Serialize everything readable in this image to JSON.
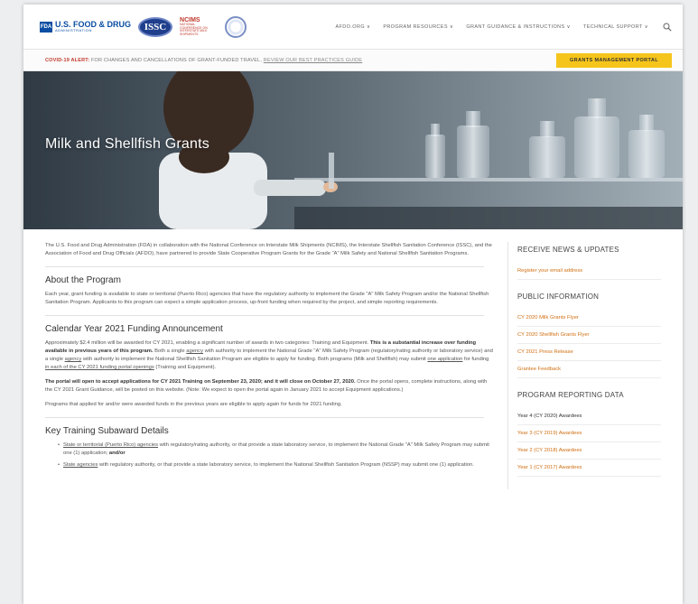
{
  "header": {
    "logos": {
      "fda_box": "FDA",
      "fda_line1": "U.S. FOOD & DRUG",
      "fda_line2": "ADMINISTRATION",
      "issc": "ISSC",
      "ncims_line1": "NCIMS",
      "ncims_line2": "NATIONAL CONFERENCE ON INTERSTATE MILK SHIPMENTS"
    },
    "menu": [
      "AFDO.ORG ∨",
      "PROGRAM RESOURCES ∨",
      "GRANT GUIDANCE & INSTRUCTIONS ∨",
      "TECHNICAL SUPPORT ∨"
    ],
    "search_icon": "search-icon"
  },
  "alert": {
    "label": "COVID-19 ALERT:",
    "text": " FOR CHANGES AND CANCELLATIONS OF GRANT-FUNDED TRAVEL, ",
    "link": "REVIEW OUR BEST PRACTICES GUIDE",
    "portal_button": "GRANTS MANAGEMENT PORTAL"
  },
  "hero": {
    "title": "Milk and Shellfish Grants"
  },
  "main": {
    "intro": "The U.S. Food and Drug Administration (FDA) in collaboration with the National Conference on Interstate Milk Shipments (NCIMS), the Interstate Shellfish Sanitation Conference (ISSC), and the Association of Food and Drug Officials (AFDO), have partnered to provide State Cooperative Program Grants for the Grade \"A\" Milk Safety and National Shellfish Sanitation Programs.",
    "about_heading": "About the Program",
    "about_text": "Each year, grant funding is available to state or territorial (Puerto Rico) agencies that have the regulatory authority to implement the Grade \"A\" Milk Safety Program and/or the National Shellfish Sanitation Program. Applicants to this program can expect a simple application process, up-front funding when required by the project, and simple reporting requirements.",
    "funding_heading": "Calendar Year 2021 Funding Announcement",
    "funding_p1_a": "Approximately $2.4 million will be awarded for CY 2021, enabling a significant number of awards in two categories: Training and Equipment. ",
    "funding_p1_b": "This is a substantial increase over funding available in previous years of this program.",
    "funding_p1_c": " Both a single ",
    "funding_p1_d": "agency",
    "funding_p1_e": " with authority to implement the National Grade \"A\" Milk Safety Program (regulatory/rating authority or laboratory service) and a single ",
    "funding_p1_f": "agency",
    "funding_p1_g": " with authority to implement the National Shellfish Sanitation Program are eligible to apply for funding. Both programs (Milk and Shellfish) may submit ",
    "funding_p1_h": "one application",
    "funding_p1_i": " for funding ",
    "funding_p1_j": "in each of the CY 2021 funding portal openings",
    "funding_p1_k": " (Training and Equipment).",
    "funding_p2_a": "The portal will open to accept applications for CY 2021 Training on September 23, 2020; and it will close on October 27, 2020.",
    "funding_p2_b": " Once the portal opens, complete instructions, along with the CY 2021 Grant Guidance, will be posted on this website. (Note: We expect to open the portal again in January 2021 to accept Equipment applications.)",
    "funding_p3": "Programs that applied for and/or were awarded funds in the previous years are eligible to apply again for funds for 2021 funding.",
    "training_heading": "Key Training Subaward Details",
    "bullet1_a": "State or territorial (Puerto Rico) agencies",
    "bullet1_b": " with regulatory/rating authority, or that provide a state laboratory service, to implement the National Grade \"A\" Milk Safety Program may submit one (1) application; ",
    "bullet1_c": "and/or",
    "bullet2_a": "State agencies",
    "bullet2_b": " with regulatory authority, or that provide a state laboratory service, to implement the National Shellfish Sanitation Program (NSSP) may submit one (1) application."
  },
  "sidebar": {
    "news_heading": "RECEIVE NEWS & UPDATES",
    "register_link": "Register your email address",
    "public_heading": "PUBLIC INFORMATION",
    "public_links": [
      "CY 2020 Milk Grants Flyer",
      "CY 2020 Shellfish Grants Flyer",
      "CY 2021 Press Release",
      "Grantee Feedback"
    ],
    "reporting_heading": "PROGRAM REPORTING DATA",
    "reporting_links": [
      "Year 4 (CY 2020) Awardees",
      "Year 3 (CY 2019) Awardees",
      "Year 2 (CY 2018) Awardees",
      "Year 1 (CY 2017) Awardees"
    ]
  },
  "colors": {
    "accent": "#f6c51b",
    "link": "#d06f12",
    "alert": "#c0392b",
    "brand_blue": "#0b4ea2"
  }
}
